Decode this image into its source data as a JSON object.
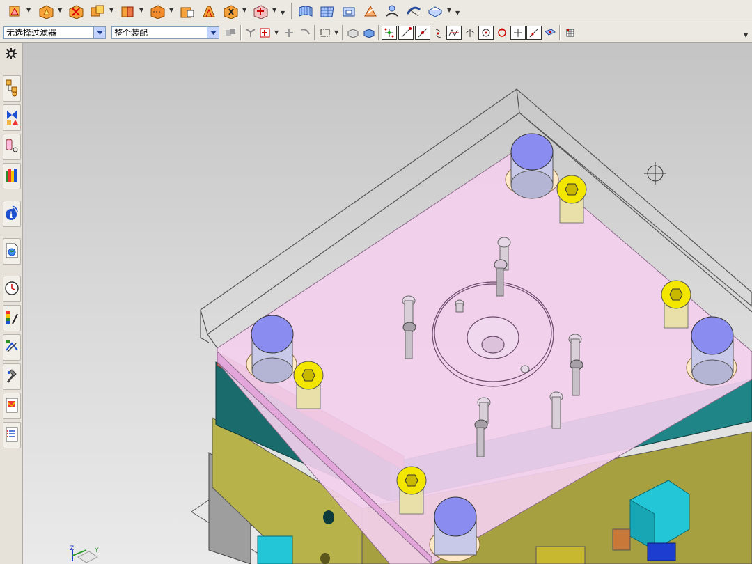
{
  "toolbar": {
    "selection_filter": "无选择过滤器",
    "scope": "整个装配"
  },
  "icons": {
    "top_row": [
      "cylinder-icon",
      "cone-icon",
      "subtract-icon",
      "unite-icon",
      "intersect-icon",
      "edge-blend-icon",
      "chamfer-icon",
      "draft-icon",
      "shell-icon",
      "move-face-icon",
      "surface-icon",
      "mesh-icon",
      "extract-icon",
      "sew-icon",
      "offset-icon",
      "trim-icon",
      "sheet-icon"
    ],
    "second_row": [
      "filter-icon",
      "select-icon",
      "snap-icon",
      "wireframe-icon",
      "shaded-icon",
      "point-icon",
      "end-point-icon",
      "mid-point-icon",
      "curve-point-icon",
      "intersection-icon",
      "tangent-icon",
      "center-icon",
      "quadrant-icon",
      "existing-point-icon",
      "on-curve-icon",
      "view-icon",
      "grid-icon"
    ],
    "sidebar": [
      "settings-icon",
      "assembly-navigator-icon",
      "constraint-navigator-icon",
      "part-navigator-icon",
      "reuse-library-icon",
      "info-icon",
      "web-browser-icon",
      "history-icon",
      "system-materials-icon",
      "process-studio-icon",
      "manufacturing-wizard-icon",
      "roles-icon",
      "palette-icon"
    ]
  },
  "colors": {
    "plate_pink": "#f3cfee",
    "guide_pin_blue": "#8a8cf0",
    "screw_yellow": "#f3e600",
    "teal_plate": "#1a6b6c",
    "olive_plate": "#b8b24a",
    "cyan_block": "#22c6d6"
  },
  "viewport": {
    "triad_z": "Z",
    "triad_y": "Y"
  }
}
